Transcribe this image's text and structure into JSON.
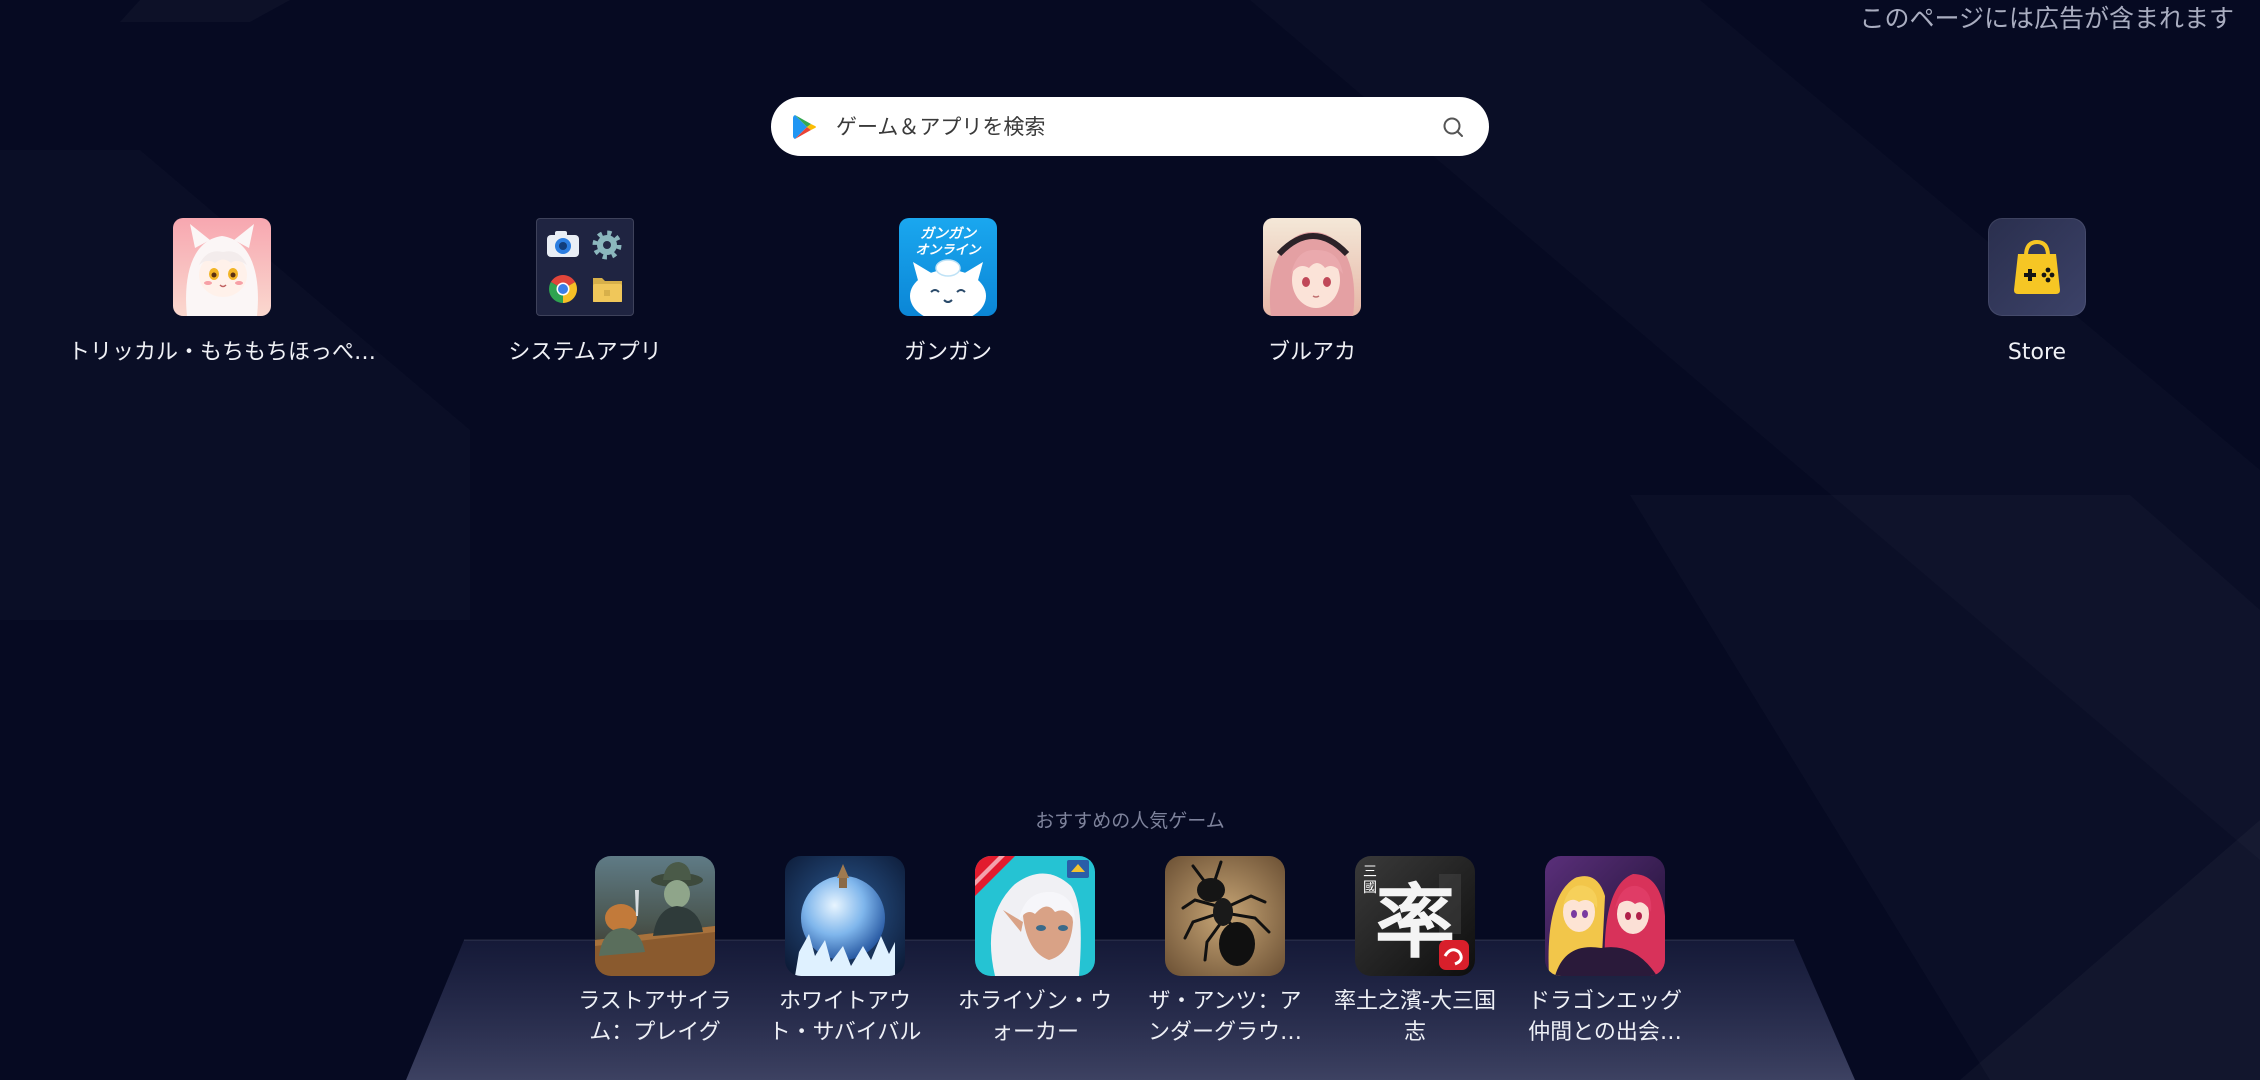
{
  "ad_notice": "このページには広告が含まれます",
  "search": {
    "placeholder": "ゲーム＆アプリを検索",
    "brand_icon": "google-play-icon",
    "action_icon": "search-icon"
  },
  "desktop_apps": [
    {
      "label": "トリッカル・もちもちほっぺ…",
      "icon": "trickcal-app-icon"
    },
    {
      "label": "システムアプリ",
      "icon": "system-apps-folder-icon",
      "contents": [
        "camera-icon",
        "settings-icon",
        "chrome-icon",
        "file-manager-icon"
      ]
    },
    {
      "label": "ガンガン",
      "icon": "gangan-online-app-icon",
      "logo_text": [
        "ガンガン",
        "オンライン"
      ]
    },
    {
      "label": "ブルアカ",
      "icon": "blue-archive-app-icon"
    },
    {
      "label": "Store",
      "icon": "store-icon"
    }
  ],
  "recommended": {
    "heading": "おすすめの人気ゲーム",
    "games": [
      {
        "label_lines": [
          "ラストアサイラ",
          "ム：プレイグ"
        ],
        "icon": "last-asylum-plague-icon"
      },
      {
        "label_lines": [
          "ホワイトアウ",
          "ト・サバイバル"
        ],
        "icon": "whiteout-survival-icon"
      },
      {
        "label_lines": [
          "ホライゾン・ウ",
          "ォーカー"
        ],
        "icon": "horizon-walker-icon"
      },
      {
        "label_lines": [
          "ザ・アンツ：ア",
          "ンダーグラウ…"
        ],
        "icon": "the-ants-icon"
      },
      {
        "label_lines": [
          "率土之濱-大三国",
          "志"
        ],
        "icon": "infinite-borders-icon",
        "logo_text": {
          "series": [
            "三",
            "國"
          ],
          "glyph": "率"
        }
      },
      {
        "label_lines": [
          "ドラゴンエッグ",
          "仲間との出会…"
        ],
        "icon": "dragon-egg-icon"
      }
    ]
  },
  "colors": {
    "background": "#060a22",
    "search_bar": "#ffffff",
    "label_text": "#f0f1f6",
    "muted_text": "#7e839c",
    "store_bag": "#f6c624"
  }
}
